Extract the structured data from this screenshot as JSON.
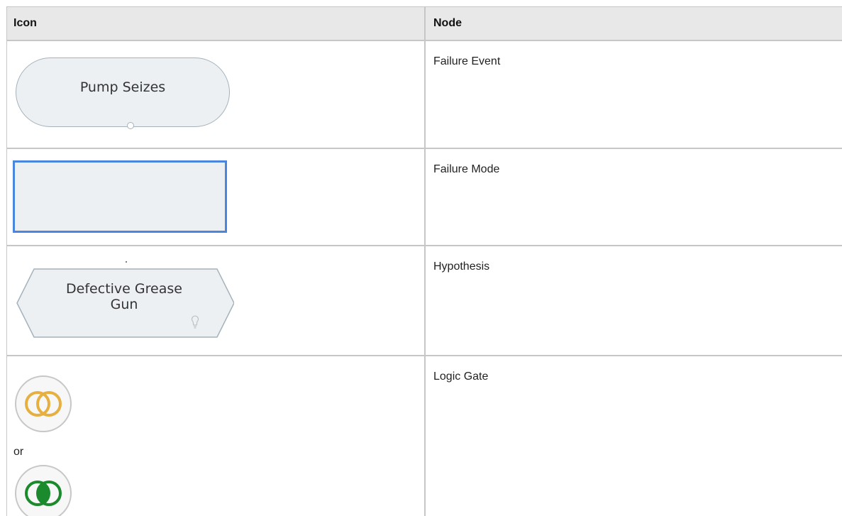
{
  "header": {
    "icon_col": "Icon",
    "node_col": "Node"
  },
  "rows": [
    {
      "icon": {
        "type": "failure-event-pill",
        "label": "Pump Seizes"
      },
      "node": "Failure Event"
    },
    {
      "icon": {
        "type": "failure-mode-rectangle",
        "label": ""
      },
      "node": "Failure Mode"
    },
    {
      "icon": {
        "type": "hypothesis-hexagon",
        "label_line1": "Defective Grease",
        "label_line2": "Gun"
      },
      "node": "Hypothesis"
    },
    {
      "icon": {
        "type": "logic-gates",
        "separator": "or",
        "gate1_color": "#e6b040",
        "gate2_color": "#1b8a2c"
      },
      "node": "Logic Gate"
    }
  ],
  "colors": {
    "header_bg": "#e8e8e8",
    "grid_line": "#c6c6c6",
    "node_fill": "#edf0f3",
    "node_stroke": "#a4b2bc",
    "failure_mode_border": "#4a86dd"
  }
}
